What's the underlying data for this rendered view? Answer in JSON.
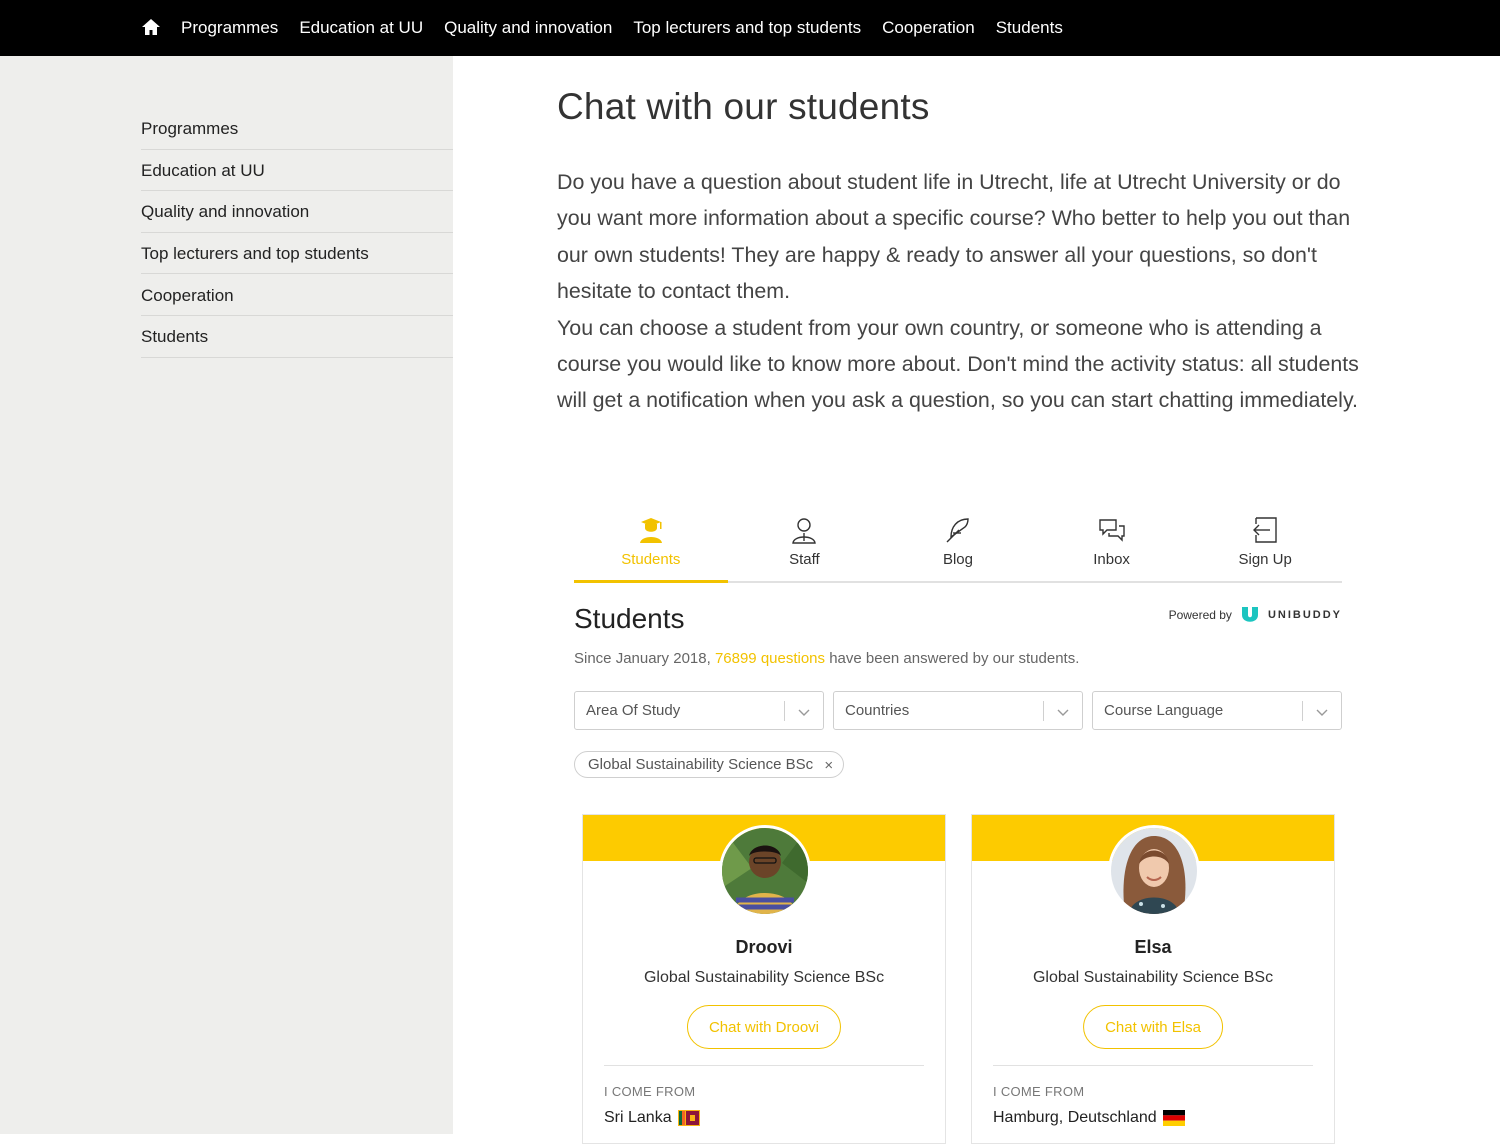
{
  "topnav": {
    "items": [
      "Programmes",
      "Education at UU",
      "Quality and innovation",
      "Top lecturers and top students",
      "Cooperation",
      "Students"
    ]
  },
  "sidebar": {
    "items": [
      "Programmes",
      "Education at UU",
      "Quality and innovation",
      "Top lecturers and top students",
      "Cooperation",
      "Students"
    ]
  },
  "main": {
    "title": "Chat with our students",
    "intro": [
      "Do you have a question about student life in Utrecht, life at Utrecht University or do you want more information about a specific course? Who better to help you out than our own students! They are happy & ready to answer all your questions, so don't hesitate to contact them.",
      "You can choose a student from your own country, or someone who is attending a course you would like to know more about. Don't mind the activity status: all students will get a notification when you ask a question, so you can start chatting immediately."
    ]
  },
  "widget": {
    "tabs": [
      "Students",
      "Staff",
      "Blog",
      "Inbox",
      "Sign Up"
    ],
    "active_tab": "Students",
    "title": "Students",
    "powered_by": "Powered by",
    "brand": "UNIBUDDY",
    "since_prefix": "Since January 2018,",
    "since_highlight": "76899 questions",
    "since_suffix": "have been answered by our students.",
    "filters": [
      "Area Of Study",
      "Countries",
      "Course Language"
    ],
    "chip": "Global Sustainability Science BSc",
    "accent_color": "#f2c200",
    "band_color": "#fdcb00",
    "cards": [
      {
        "name": "Droovi",
        "programme": "Global Sustainability Science BSc",
        "chat_label": "Chat with Droovi",
        "from_label": "I COME FROM",
        "from": "Sri Lanka",
        "flag": "sri-lanka-flag"
      },
      {
        "name": "Elsa",
        "programme": "Global Sustainability Science BSc",
        "chat_label": "Chat with Elsa",
        "from_label": "I COME FROM",
        "from": "Hamburg, Deutschland",
        "flag": "germany-flag"
      }
    ]
  }
}
